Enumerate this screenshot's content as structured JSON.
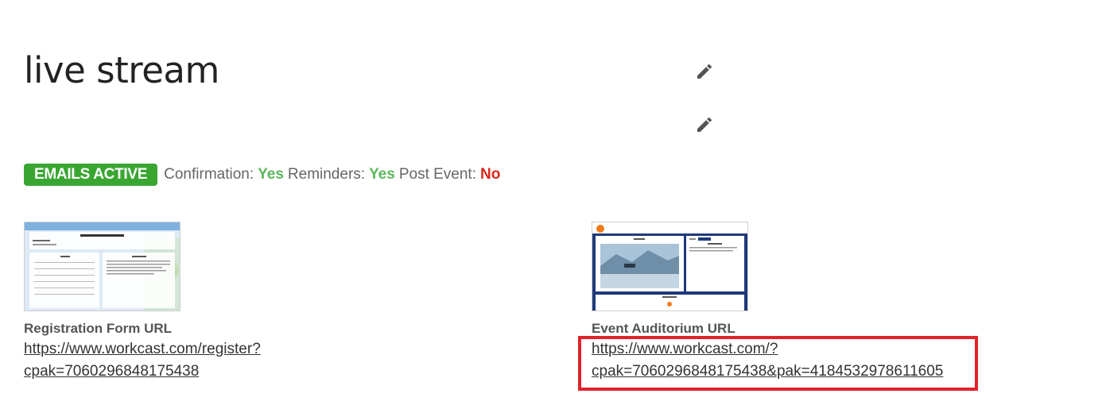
{
  "event": {
    "title": "live stream"
  },
  "emails": {
    "badge": "EMAILS ACTIVE",
    "confirmation_label": "Confirmation:",
    "confirmation_value": "Yes",
    "reminders_label": "Reminders:",
    "reminders_value": "Yes",
    "post_event_label": "Post Event:",
    "post_event_value": "No"
  },
  "registration": {
    "label": "Registration Form URL",
    "url_line1": "https://www.workcast.com/register?",
    "url_line2": "cpak=7060296848175438"
  },
  "auditorium": {
    "label": "Event Auditorium URL",
    "url_line1": "https://www.workcast.com/?",
    "url_line2": "cpak=7060296848175438&pak=4184532978611605"
  },
  "icons": {
    "edit_1": "pencil-icon",
    "edit_2": "pencil-icon"
  },
  "colors": {
    "badge_green": "#3aa632",
    "yes_green": "#5cb85c",
    "no_red": "#d9261c",
    "highlight_red": "#e0232b"
  }
}
